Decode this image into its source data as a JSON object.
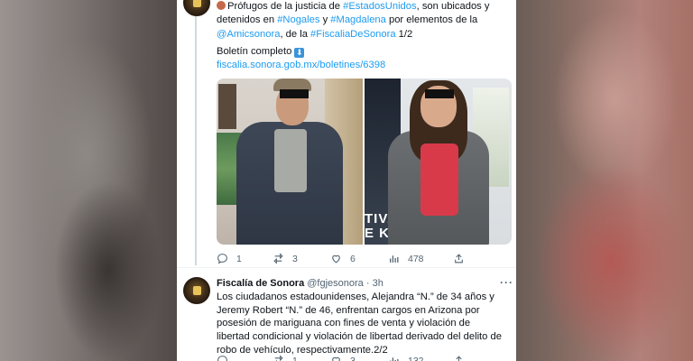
{
  "tweet1": {
    "text_prefix": "Prófugos de la justicia de ",
    "hashtag_estados": "#EstadosUnidos",
    "text_mid1": ", son ubicados y detenidos en ",
    "hashtag_nogales": "#Nogales",
    "text_y": " y ",
    "hashtag_magdalena": "#Magdalena",
    "text_mid2": " por elementos de la ",
    "mention_amic": "@Amicsonora",
    "text_dela": ", de la ",
    "hashtag_fiscalia": "#FiscaliaDeSonora",
    "text_count": " 1/2",
    "boletin_label": "Boletín completo",
    "boletin_icon": "down-arrow-icon",
    "link": "fiscalia.sonora.gob.mx/boletines/6398",
    "photo_text": "TIVA\nE KIN",
    "actions": {
      "replies": "1",
      "retweets": "3",
      "likes": "6",
      "views": "478"
    }
  },
  "tweet2": {
    "author": "Fiscalía de Sonora",
    "handle": "@fgjesonora",
    "time": "· 3h",
    "more": "···",
    "text": "Los ciudadanos estadounidenses, Alejandra “N.” de 34 años y Jeremy Robert “N.” de 46, enfrentan cargos en Arizona por posesión de mariguana con fines de venta y violación de libertad condicional y violación de libertad derivado del delito de robo de vehículo, respectivamente.2/2",
    "actions": {
      "replies": "",
      "retweets": "1",
      "likes": "3",
      "views": "132"
    }
  },
  "colors": {
    "link": "#1d9bf0",
    "text": "#0f1419",
    "muted": "#536471"
  }
}
